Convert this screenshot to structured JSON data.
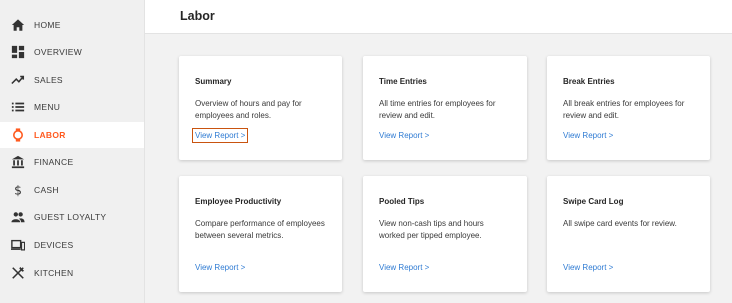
{
  "sidebar": {
    "items": [
      {
        "label": "HOME",
        "icon": "home-icon"
      },
      {
        "label": "OVERVIEW",
        "icon": "dashboard-icon"
      },
      {
        "label": "SALES",
        "icon": "trending-up-icon"
      },
      {
        "label": "MENU",
        "icon": "list-icon"
      },
      {
        "label": "LABOR",
        "icon": "watch-icon"
      },
      {
        "label": "FINANCE",
        "icon": "bank-icon"
      },
      {
        "label": "CASH",
        "icon": "dollar-icon"
      },
      {
        "label": "GUEST LOYALTY",
        "icon": "people-icon"
      },
      {
        "label": "DEVICES",
        "icon": "devices-icon"
      },
      {
        "label": "KITCHEN",
        "icon": "utensils-icon"
      }
    ],
    "active_item": "LABOR"
  },
  "header": {
    "title": "Labor"
  },
  "cards": [
    {
      "title": "Summary",
      "description": "Overview of hours and pay for employees and roles.",
      "link": "View Report >"
    },
    {
      "title": "Time Entries",
      "description": "All time entries for employees for review and edit.",
      "link": "View Report >"
    },
    {
      "title": "Break Entries",
      "description": "All break entries for employees for review and edit.",
      "link": "View Report >"
    },
    {
      "title": "Employee Productivity",
      "description": "Compare performance of employees between several metrics.",
      "link": "View Report >"
    },
    {
      "title": "Pooled Tips",
      "description": "View non-cash tips and hours worked per tipped employee.",
      "link": "View Report >"
    },
    {
      "title": "Swipe Card Log",
      "description": "All swipe card events for review.",
      "link": "View Report >"
    }
  ],
  "colors": {
    "accent": "#ff5a1f",
    "link": "#2f7bd3",
    "highlight_outline": "#c9540f"
  }
}
